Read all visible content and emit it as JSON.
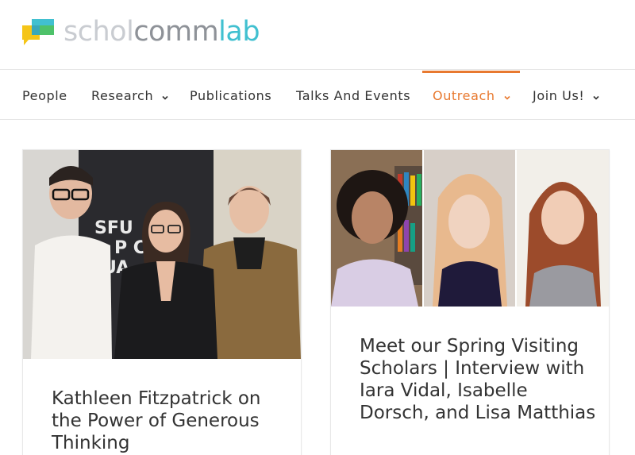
{
  "logo": {
    "part1": "schol",
    "part2": "comm",
    "part3": "lab"
  },
  "nav": {
    "items": [
      {
        "label": "People",
        "has_dropdown": false
      },
      {
        "label": "Research",
        "has_dropdown": true
      },
      {
        "label": "Publications",
        "has_dropdown": false
      },
      {
        "label": "Talks And Events",
        "has_dropdown": false
      },
      {
        "label": "Outreach",
        "has_dropdown": true,
        "active": true
      },
      {
        "label": "Join Us!",
        "has_dropdown": true
      }
    ],
    "active_color": "#e8792f"
  },
  "cards": [
    {
      "title": "Kathleen Fitzpatrick on the Power of Generous Thinking",
      "image_icon": "group-photo-icon"
    },
    {
      "title": "Meet our Spring Visiting Scholars | Interview with Iara Vidal, Isabelle Dorsch, and Lisa Matthias",
      "image_icon": "portrait-collage-icon"
    }
  ],
  "colors": {
    "brand_teal": "#41c0d0",
    "brand_green": "#4ec26a",
    "brand_yellow": "#f5c518",
    "accent_orange": "#e8792f"
  }
}
